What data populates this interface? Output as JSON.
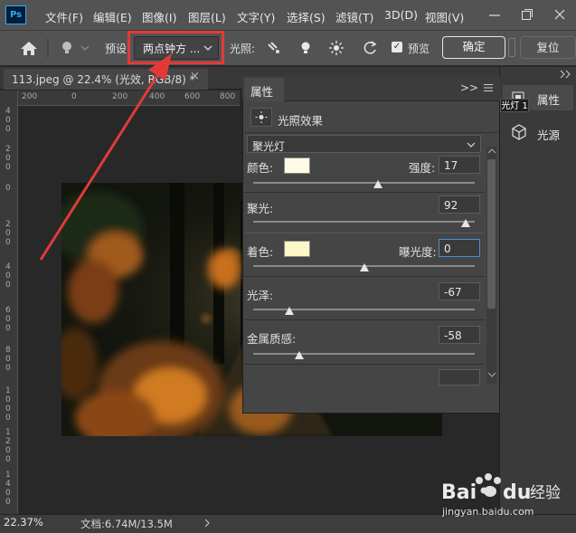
{
  "app": {
    "logo_text": "Ps"
  },
  "menu": [
    "文件(F)",
    "编辑(E)",
    "图像(I)",
    "图层(L)",
    "文字(Y)",
    "选择(S)",
    "滤镜(T)",
    "3D(D)",
    "视图(V)"
  ],
  "options_bar": {
    "preset_label": "预设:",
    "preset_value": "两点钟方 ...",
    "light_label": "光照:",
    "preview_label": "预览",
    "ok_label": "确定",
    "reset_label": "复位"
  },
  "document": {
    "tab_title": "113.jpeg @ 22.4% (光效, RGB/8) *",
    "tab_close": "×"
  },
  "rulers": {
    "top": [
      "200",
      "0",
      "200",
      "400",
      "600",
      "800"
    ],
    "left": [
      "4\n0\n0",
      "2\n0\n0",
      "0",
      "2\n0\n0",
      "4\n0\n0",
      "6\n0\n0",
      "8\n0\n0",
      "1\n0\n0\n0",
      "1\n2\n0\n0",
      "1\n4\n0\n0"
    ]
  },
  "properties_panel": {
    "tab_label": "属性",
    "collapse": ">>",
    "section_title": "光照效果",
    "light_type": "聚光灯",
    "color_label": "颜色:",
    "intensity_label": "强度:",
    "intensity_value": "17",
    "hotspot_label": "聚光:",
    "hotspot_value": "92",
    "colorize_label": "着色:",
    "exposure_label": "曝光度:",
    "exposure_value": "0",
    "gloss_label": "光泽:",
    "gloss_value": "-67",
    "metallic_label": "金属质感:",
    "metallic_value": "-58",
    "light_color": "#fffbe6",
    "colorize_color": "#fdf7c8",
    "sliders": {
      "intensity": 0.565,
      "hotspot": 0.96,
      "exposure": 0.5,
      "gloss": 0.165,
      "metallic": 0.21
    }
  },
  "dock": {
    "properties_label": "属性",
    "light_source_label": "光源",
    "tooltip": "光灯 1"
  },
  "status_bar": {
    "zoom": "22.37%",
    "doc_info": "文档:6.74M/13.5M"
  },
  "watermark": {
    "brand": "Baidu经验",
    "url": "jingyan.baidu.com"
  },
  "colors": {
    "accent": "#31a8ff",
    "annotation_red": "#e23a3a"
  }
}
